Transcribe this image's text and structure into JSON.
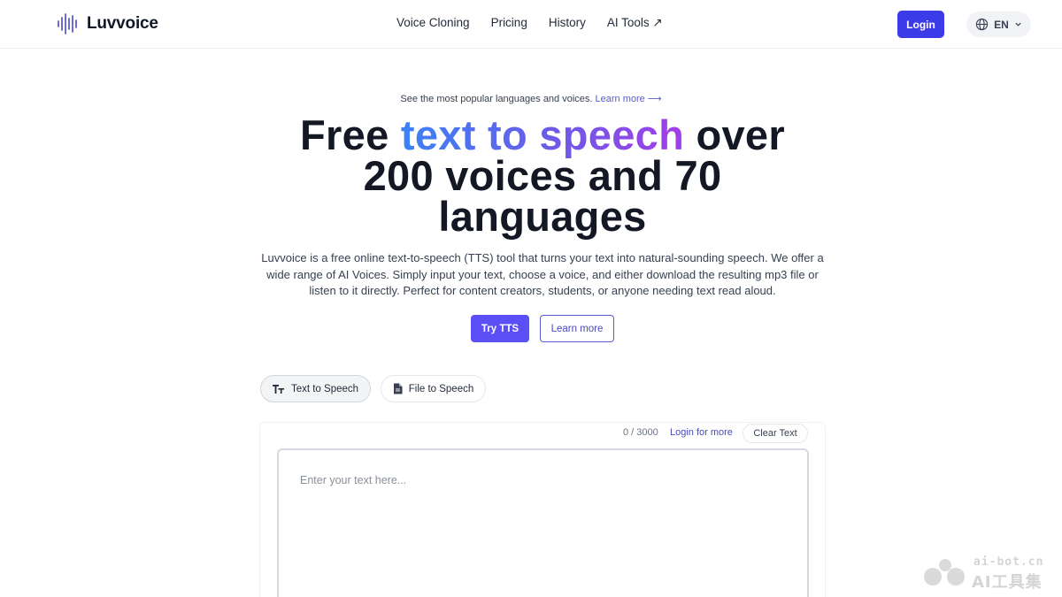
{
  "brand": {
    "name": "Luvvoice",
    "logo_icon": "sound-wave-icon"
  },
  "nav": {
    "items": [
      {
        "label": "Voice Cloning"
      },
      {
        "label": "Pricing"
      },
      {
        "label": "History"
      },
      {
        "label": "AI Tools ↗"
      }
    ]
  },
  "header": {
    "login_label": "Login",
    "lang_label": "EN",
    "lang_icon": "globe-icon",
    "lang_chevron": "chevron-down-icon"
  },
  "announcement": {
    "text": "See the most popular languages and voices.",
    "link": "Learn more ⟶"
  },
  "hero": {
    "title_pre": "Free ",
    "title_highlight": "text to speech",
    "title_post": " over 200 voices and 70 languages",
    "subtitle": "Luvvoice is a free online text-to-speech (TTS) tool that turns your text into natural-sounding speech. We offer a wide range of AI Voices. Simply input your text, choose a voice, and either download the resulting mp3 file or listen to it directly. Perfect for content creators, students, or anyone needing text read aloud.",
    "primary_button": "Try TTS",
    "secondary_button": "Learn more",
    "accent_colors": [
      "#3b82f6",
      "#6d5ae6",
      "#a23ee8"
    ]
  },
  "tabs": [
    {
      "label": "Text to Speech",
      "icon": "text-size-icon",
      "active": true
    },
    {
      "label": "File to Speech",
      "icon": "file-icon",
      "active": false
    }
  ],
  "editor": {
    "counter": "0 / 3000",
    "login_more": "Login for more",
    "clear_label": "Clear Text",
    "value": "",
    "placeholder": "Enter your text here..."
  },
  "watermark": {
    "url": "ai-bot.cn",
    "name": "AI工具集"
  },
  "colors": {
    "primary": "#3b3be8",
    "try_button": "#5b4ff5",
    "link": "#5b5bd6"
  }
}
